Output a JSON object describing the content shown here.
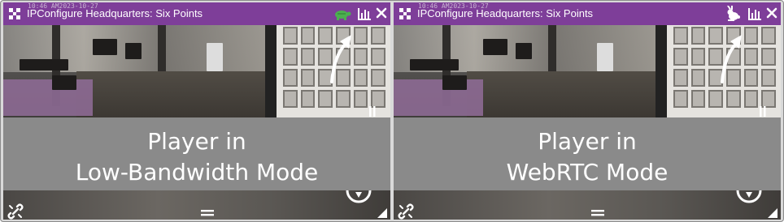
{
  "panels": [
    {
      "id": "low-bandwidth",
      "timestamp": "10:46 AM2023-10-27",
      "title": "IPConfigure Headquarters: Six Points",
      "mode_icon": "turtle-icon",
      "mode_color": "#4caf50",
      "caption_line1": "Player in",
      "caption_line2": "Low-Bandwidth Mode"
    },
    {
      "id": "webrtc",
      "timestamp": "10:46 AM2023-10-27",
      "title": "IPConfigure Headquarters: Six Points",
      "mode_icon": "rabbit-icon",
      "mode_color": "#ffffff",
      "caption_line1": "Player in",
      "caption_line2": "WebRTC Mode"
    }
  ],
  "colors": {
    "titlebar": "#7e3e99",
    "caption_bg": "#8a8a8a"
  }
}
